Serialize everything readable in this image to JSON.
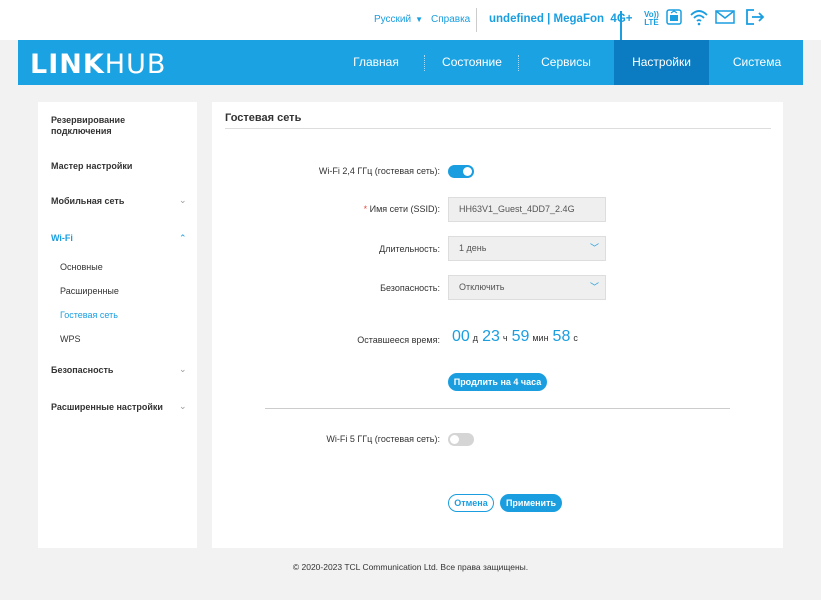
{
  "topbar": {
    "language": "Русский",
    "help": "Справка",
    "carrier": "undefined | MegaFon",
    "network": "4G+",
    "volte_top": "Vo))",
    "volte_bottom": "LTE"
  },
  "logo": {
    "bold": "LINK",
    "light": "HUB"
  },
  "nav": {
    "home": "Главная",
    "status": "Состояние",
    "services": "Сервисы",
    "settings": "Настройки",
    "system": "Система"
  },
  "sidebar": {
    "backup": "Резервирование подключения",
    "wizard": "Мастер настройки",
    "mobile": "Мобильная сеть",
    "wifi": "Wi-Fi",
    "wifi_basic": "Основные",
    "wifi_advanced": "Расширенные",
    "wifi_guest": "Гостевая сеть",
    "wifi_wps": "WPS",
    "security": "Безопасность",
    "advanced": "Расширенные настройки"
  },
  "main": {
    "title": "Гостевая сеть",
    "wifi24_label": "Wi-Fi 2,4 ГГц (гостевая сеть):",
    "wifi24_enabled": true,
    "ssid_required_mark": "*",
    "ssid_label": "Имя сети (SSID):",
    "ssid_value": "HH63V1_Guest_4DD7_2.4G",
    "duration_label": "Длительность:",
    "duration_value": "1 день",
    "security_label": "Безопасность:",
    "security_value": "Отключить",
    "remaining_label": "Оставшееся время:",
    "remaining": {
      "days": "00",
      "days_unit": "д",
      "hours": "23",
      "hours_unit": "ч",
      "minutes": "59",
      "minutes_unit": "мин",
      "seconds": "58",
      "seconds_unit": "с"
    },
    "extend_button": "Продлить на 4 часа",
    "wifi5_label": "Wi-Fi 5 ГГц (гостевая сеть):",
    "wifi5_enabled": false,
    "cancel_button": "Отмена",
    "apply_button": "Применить"
  },
  "footer": {
    "text": "© 2020-2023 TCL Communication Ltd. Все права защищены."
  },
  "colors": {
    "accent": "#1ba2e2",
    "active_nav": "#0b7cc1"
  }
}
